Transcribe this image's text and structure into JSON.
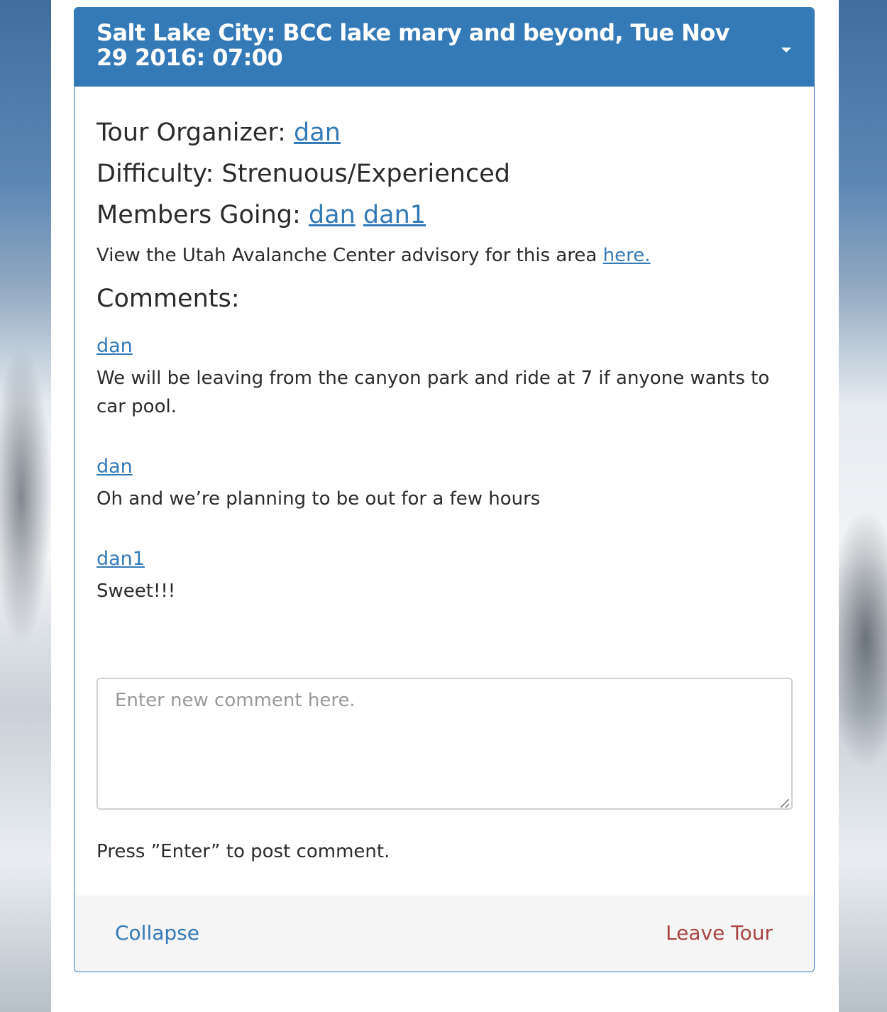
{
  "panel": {
    "title": "Salt Lake City: BCC lake mary and beyond, Tue Nov 29 2016: 07:00",
    "organizer_label": "Tour Organizer: ",
    "organizer": "dan",
    "difficulty_label": "Difficulty: ",
    "difficulty": "Strenuous/Experienced",
    "members_label": "Members Going: ",
    "members": [
      "dan",
      "dan1"
    ],
    "advisory_text": "View the Utah Avalanche Center advisory for this area ",
    "advisory_link": "here.",
    "comments_heading": "Comments:",
    "comments": [
      {
        "author": "dan",
        "text": "We will be leaving from the canyon park and ride at 7 if anyone wants to car pool."
      },
      {
        "author": "dan",
        "text": "Oh and we’re planning to be out for a few hours"
      },
      {
        "author": "dan1",
        "text": "Sweet!!!"
      }
    ],
    "comment_input": {
      "placeholder": "Enter new comment here.",
      "value": ""
    },
    "hint": "Press ”Enter” to post comment.",
    "footer": {
      "collapse_label": "Collapse",
      "leave_label": "Leave Tour"
    }
  },
  "colors": {
    "primary": "#337ab7",
    "danger": "#a94442",
    "footer_bg": "#f5f5f5"
  }
}
